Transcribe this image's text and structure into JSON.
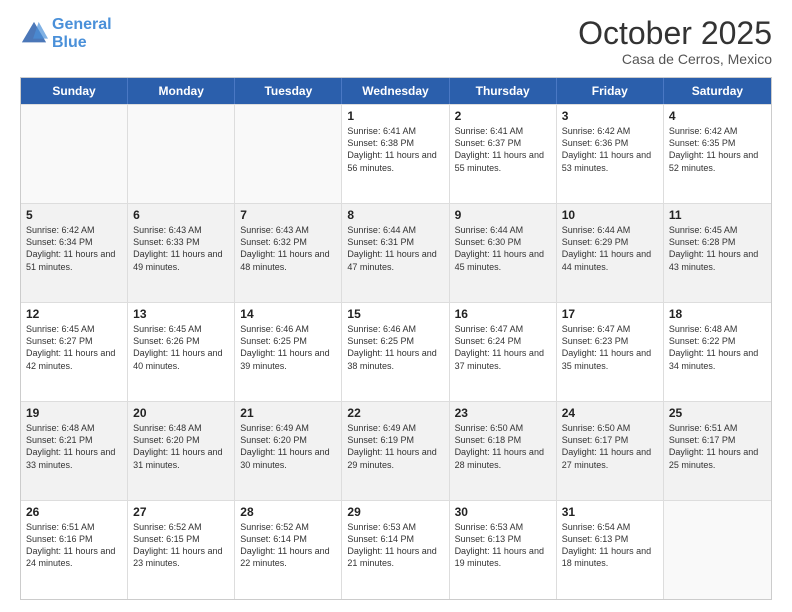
{
  "header": {
    "logo_line1": "General",
    "logo_line2": "Blue",
    "month": "October 2025",
    "location": "Casa de Cerros, Mexico"
  },
  "days_of_week": [
    "Sunday",
    "Monday",
    "Tuesday",
    "Wednesday",
    "Thursday",
    "Friday",
    "Saturday"
  ],
  "weeks": [
    [
      {
        "day": "",
        "empty": true
      },
      {
        "day": "",
        "empty": true
      },
      {
        "day": "",
        "empty": true
      },
      {
        "day": "1",
        "rise": "Sunrise: 6:41 AM",
        "set": "Sunset: 6:38 PM",
        "daylight": "Daylight: 11 hours and 56 minutes."
      },
      {
        "day": "2",
        "rise": "Sunrise: 6:41 AM",
        "set": "Sunset: 6:37 PM",
        "daylight": "Daylight: 11 hours and 55 minutes."
      },
      {
        "day": "3",
        "rise": "Sunrise: 6:42 AM",
        "set": "Sunset: 6:36 PM",
        "daylight": "Daylight: 11 hours and 53 minutes."
      },
      {
        "day": "4",
        "rise": "Sunrise: 6:42 AM",
        "set": "Sunset: 6:35 PM",
        "daylight": "Daylight: 11 hours and 52 minutes."
      }
    ],
    [
      {
        "day": "5",
        "rise": "Sunrise: 6:42 AM",
        "set": "Sunset: 6:34 PM",
        "daylight": "Daylight: 11 hours and 51 minutes."
      },
      {
        "day": "6",
        "rise": "Sunrise: 6:43 AM",
        "set": "Sunset: 6:33 PM",
        "daylight": "Daylight: 11 hours and 49 minutes."
      },
      {
        "day": "7",
        "rise": "Sunrise: 6:43 AM",
        "set": "Sunset: 6:32 PM",
        "daylight": "Daylight: 11 hours and 48 minutes."
      },
      {
        "day": "8",
        "rise": "Sunrise: 6:44 AM",
        "set": "Sunset: 6:31 PM",
        "daylight": "Daylight: 11 hours and 47 minutes."
      },
      {
        "day": "9",
        "rise": "Sunrise: 6:44 AM",
        "set": "Sunset: 6:30 PM",
        "daylight": "Daylight: 11 hours and 45 minutes."
      },
      {
        "day": "10",
        "rise": "Sunrise: 6:44 AM",
        "set": "Sunset: 6:29 PM",
        "daylight": "Daylight: 11 hours and 44 minutes."
      },
      {
        "day": "11",
        "rise": "Sunrise: 6:45 AM",
        "set": "Sunset: 6:28 PM",
        "daylight": "Daylight: 11 hours and 43 minutes."
      }
    ],
    [
      {
        "day": "12",
        "rise": "Sunrise: 6:45 AM",
        "set": "Sunset: 6:27 PM",
        "daylight": "Daylight: 11 hours and 42 minutes."
      },
      {
        "day": "13",
        "rise": "Sunrise: 6:45 AM",
        "set": "Sunset: 6:26 PM",
        "daylight": "Daylight: 11 hours and 40 minutes."
      },
      {
        "day": "14",
        "rise": "Sunrise: 6:46 AM",
        "set": "Sunset: 6:25 PM",
        "daylight": "Daylight: 11 hours and 39 minutes."
      },
      {
        "day": "15",
        "rise": "Sunrise: 6:46 AM",
        "set": "Sunset: 6:25 PM",
        "daylight": "Daylight: 11 hours and 38 minutes."
      },
      {
        "day": "16",
        "rise": "Sunrise: 6:47 AM",
        "set": "Sunset: 6:24 PM",
        "daylight": "Daylight: 11 hours and 37 minutes."
      },
      {
        "day": "17",
        "rise": "Sunrise: 6:47 AM",
        "set": "Sunset: 6:23 PM",
        "daylight": "Daylight: 11 hours and 35 minutes."
      },
      {
        "day": "18",
        "rise": "Sunrise: 6:48 AM",
        "set": "Sunset: 6:22 PM",
        "daylight": "Daylight: 11 hours and 34 minutes."
      }
    ],
    [
      {
        "day": "19",
        "rise": "Sunrise: 6:48 AM",
        "set": "Sunset: 6:21 PM",
        "daylight": "Daylight: 11 hours and 33 minutes."
      },
      {
        "day": "20",
        "rise": "Sunrise: 6:48 AM",
        "set": "Sunset: 6:20 PM",
        "daylight": "Daylight: 11 hours and 31 minutes."
      },
      {
        "day": "21",
        "rise": "Sunrise: 6:49 AM",
        "set": "Sunset: 6:20 PM",
        "daylight": "Daylight: 11 hours and 30 minutes."
      },
      {
        "day": "22",
        "rise": "Sunrise: 6:49 AM",
        "set": "Sunset: 6:19 PM",
        "daylight": "Daylight: 11 hours and 29 minutes."
      },
      {
        "day": "23",
        "rise": "Sunrise: 6:50 AM",
        "set": "Sunset: 6:18 PM",
        "daylight": "Daylight: 11 hours and 28 minutes."
      },
      {
        "day": "24",
        "rise": "Sunrise: 6:50 AM",
        "set": "Sunset: 6:17 PM",
        "daylight": "Daylight: 11 hours and 27 minutes."
      },
      {
        "day": "25",
        "rise": "Sunrise: 6:51 AM",
        "set": "Sunset: 6:17 PM",
        "daylight": "Daylight: 11 hours and 25 minutes."
      }
    ],
    [
      {
        "day": "26",
        "rise": "Sunrise: 6:51 AM",
        "set": "Sunset: 6:16 PM",
        "daylight": "Daylight: 11 hours and 24 minutes."
      },
      {
        "day": "27",
        "rise": "Sunrise: 6:52 AM",
        "set": "Sunset: 6:15 PM",
        "daylight": "Daylight: 11 hours and 23 minutes."
      },
      {
        "day": "28",
        "rise": "Sunrise: 6:52 AM",
        "set": "Sunset: 6:14 PM",
        "daylight": "Daylight: 11 hours and 22 minutes."
      },
      {
        "day": "29",
        "rise": "Sunrise: 6:53 AM",
        "set": "Sunset: 6:14 PM",
        "daylight": "Daylight: 11 hours and 21 minutes."
      },
      {
        "day": "30",
        "rise": "Sunrise: 6:53 AM",
        "set": "Sunset: 6:13 PM",
        "daylight": "Daylight: 11 hours and 19 minutes."
      },
      {
        "day": "31",
        "rise": "Sunrise: 6:54 AM",
        "set": "Sunset: 6:13 PM",
        "daylight": "Daylight: 11 hours and 18 minutes."
      },
      {
        "day": "",
        "empty": true
      }
    ]
  ]
}
